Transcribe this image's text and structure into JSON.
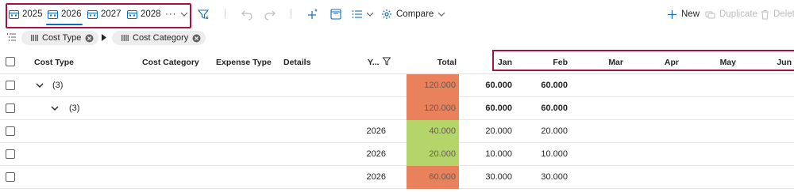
{
  "toolbar": {
    "years": [
      {
        "label": "2025",
        "active": false
      },
      {
        "label": "2026",
        "active": true
      },
      {
        "label": "2027",
        "active": false
      },
      {
        "label": "2028",
        "active": false
      }
    ],
    "more_label": "···",
    "compare_label": "Compare",
    "new_label": "New",
    "duplicate_label": "Duplicate",
    "delete_label": "Delete"
  },
  "grouping": {
    "chips": [
      {
        "label": "Cost Type"
      },
      {
        "label": "Cost Category"
      }
    ]
  },
  "grid": {
    "columns": {
      "cost_type": "Cost Type",
      "cost_category": "Cost Category",
      "expense_type": "Expense Type",
      "details": "Details",
      "year": "Y...",
      "total": "Total",
      "months": [
        "Jan",
        "Feb",
        "Mar",
        "Apr",
        "May",
        "Jun"
      ]
    },
    "rows": [
      {
        "group_label": "(3)",
        "year": "",
        "total": "120.000",
        "jan": "60.000",
        "feb": "60.000",
        "bold": true
      },
      {
        "group_label": "(3)",
        "year": "",
        "total": "120.000",
        "jan": "60.000",
        "feb": "60.000",
        "bold": true
      },
      {
        "group_label": "",
        "year": "2026",
        "total": "40.000",
        "jan": "20.000",
        "feb": "20.000",
        "bold": false
      },
      {
        "group_label": "",
        "year": "2026",
        "total": "20.000",
        "jan": "10.000",
        "feb": "10.000",
        "bold": false
      },
      {
        "group_label": "",
        "year": "2026",
        "total": "60.000",
        "jan": "30.000",
        "feb": "30.000",
        "bold": false
      }
    ]
  },
  "colors": {
    "accent": "#0f6cbd",
    "highlight_border": "#a3134a",
    "total_high": "#e8815c",
    "total_low": "#b3d56a"
  },
  "icons": {
    "year_tab": "calendar-icon",
    "filter": "filter-icon",
    "undo": "undo-icon",
    "redo": "redo-icon",
    "plus_sparkle": "add-sparkle-icon",
    "panel": "panel-icon",
    "list": "list-options-icon",
    "compare": "compare-icon",
    "new": "add-icon",
    "duplicate": "duplicate-icon",
    "delete": "delete-icon",
    "grouping": "group-by-icon",
    "chip_drag": "drag-handle-icon",
    "chip_remove": "remove-circle-icon",
    "expand": "chevron-down-icon"
  }
}
